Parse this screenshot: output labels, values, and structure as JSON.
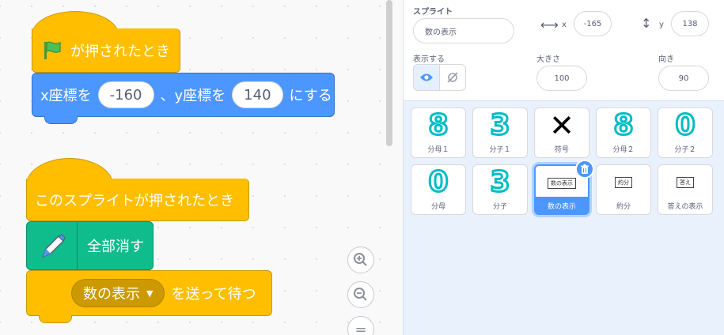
{
  "script1": {
    "hat_label": "が押されたとき",
    "motion_x_label": "x座標を",
    "motion_x_value": "-160",
    "motion_y_label": "、y座標を",
    "motion_y_value": "140",
    "motion_suffix": "にする"
  },
  "script2": {
    "hat_label": "このスプライトが押されたとき",
    "pen_label": "全部消す",
    "broadcast_option": "数の表示",
    "broadcast_label": "を送って待つ"
  },
  "zoom": {
    "in": "+",
    "out": "−",
    "reset": "="
  },
  "sprite_info": {
    "sprite_label": "スプライト",
    "sprite_name": "数の表示",
    "x_label": "x",
    "x_value": "-165",
    "y_label": "y",
    "y_value": "138",
    "show_label": "表示する",
    "size_label": "大きさ",
    "size_value": "100",
    "direction_label": "向き",
    "direction_value": "90"
  },
  "sprites": [
    {
      "name": "分母１",
      "glyph": "8",
      "kind": "digit"
    },
    {
      "name": "分子１",
      "glyph": "3",
      "kind": "digit"
    },
    {
      "name": "符号",
      "glyph": "✕",
      "kind": "cross"
    },
    {
      "name": "分母２",
      "glyph": "8",
      "kind": "digit"
    },
    {
      "name": "分子２",
      "glyph": "0",
      "kind": "digit"
    },
    {
      "name": "分母",
      "glyph": "0",
      "kind": "digit"
    },
    {
      "name": "分子",
      "glyph": "3",
      "kind": "digit"
    },
    {
      "name": "数の表示",
      "glyph": "数の表示",
      "kind": "mini",
      "selected": true
    },
    {
      "name": "約分",
      "glyph": "約分",
      "kind": "mini"
    },
    {
      "name": "答えの表示",
      "glyph": "答え",
      "kind": "mini"
    }
  ],
  "colors": {
    "events": "#ffbf00",
    "motion": "#4c97ff",
    "pen": "#0fbd8c",
    "accent": "#4c97ff",
    "digit_outline": "#00bcc6"
  }
}
